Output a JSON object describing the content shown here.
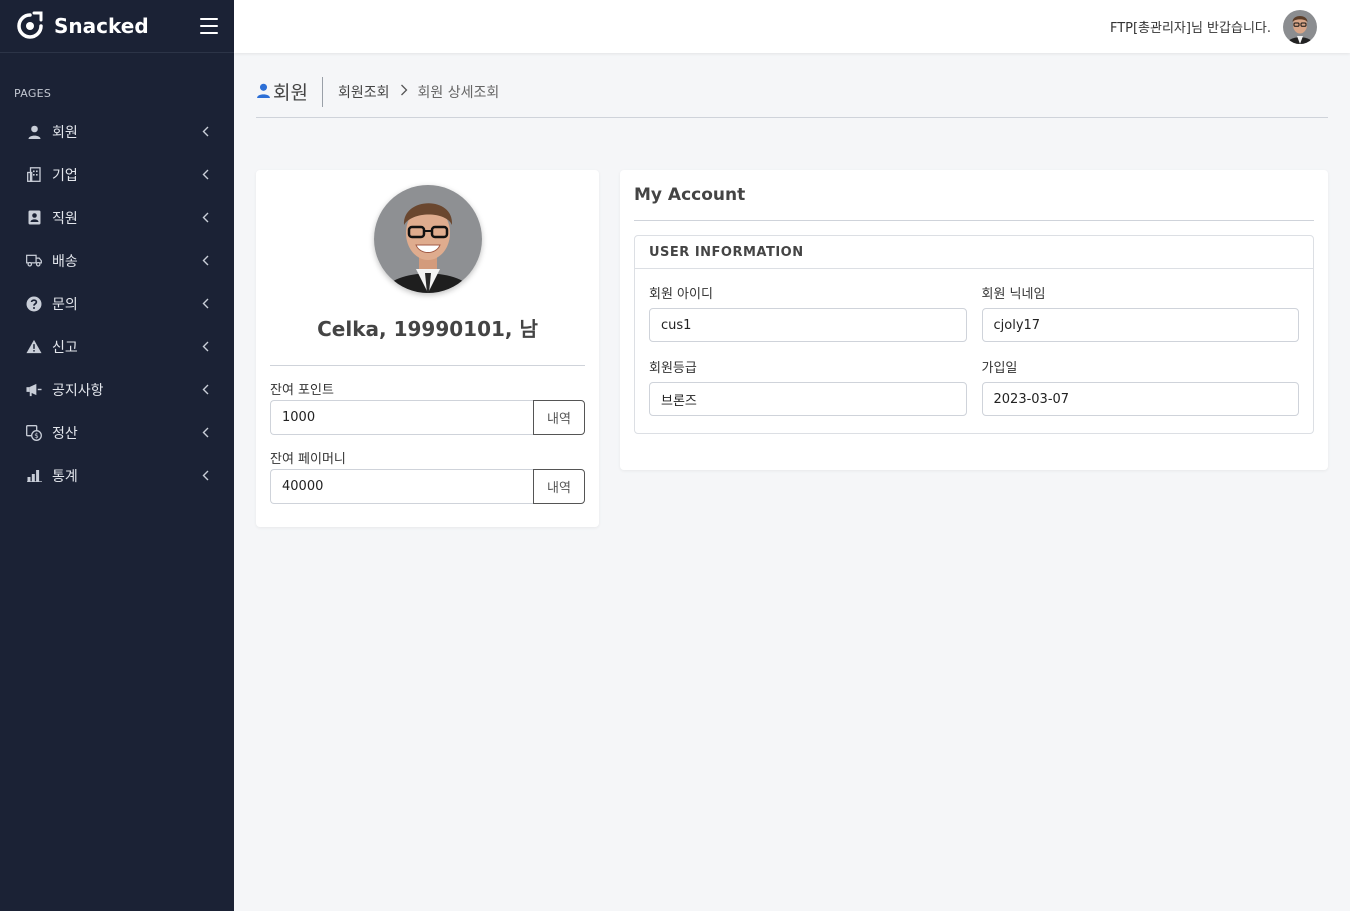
{
  "brand": {
    "name": "Snacked"
  },
  "sidebar": {
    "section": "PAGES",
    "items": [
      {
        "label": "회원",
        "icon": "person-icon"
      },
      {
        "label": "기업",
        "icon": "building-icon"
      },
      {
        "label": "직원",
        "icon": "badge-icon"
      },
      {
        "label": "배송",
        "icon": "truck-icon"
      },
      {
        "label": "문의",
        "icon": "question-icon"
      },
      {
        "label": "신고",
        "icon": "warning-icon"
      },
      {
        "label": "공지사항",
        "icon": "megaphone-icon"
      },
      {
        "label": "정산",
        "icon": "settlement-icon"
      },
      {
        "label": "통계",
        "icon": "chart-icon"
      }
    ]
  },
  "header": {
    "welcome": "FTP[총관리자]님 반갑습니다."
  },
  "page": {
    "title": "회원",
    "breadcrumb": [
      "회원조회",
      "회원 상세조회"
    ]
  },
  "profile": {
    "name": "Celka, 19990101, 남",
    "points_label": "잔여 포인트",
    "points_value": "1000",
    "money_label": "잔여 페이머니",
    "money_value": "40000",
    "history_button": "내역"
  },
  "account": {
    "title": "My Account",
    "section": "USER INFORMATION",
    "fields": {
      "id_label": "회원 아이디",
      "id_value": "cus1",
      "nickname_label": "회원 닉네임",
      "nickname_value": "cjoly17",
      "grade_label": "회원등급",
      "grade_value": "브론즈",
      "joined_label": "가입일",
      "joined_value": "2023-03-07"
    }
  },
  "colors": {
    "sidebar_bg": "#1b2235",
    "page_bg": "#f5f6f8",
    "accent": "#2d6fd6"
  }
}
